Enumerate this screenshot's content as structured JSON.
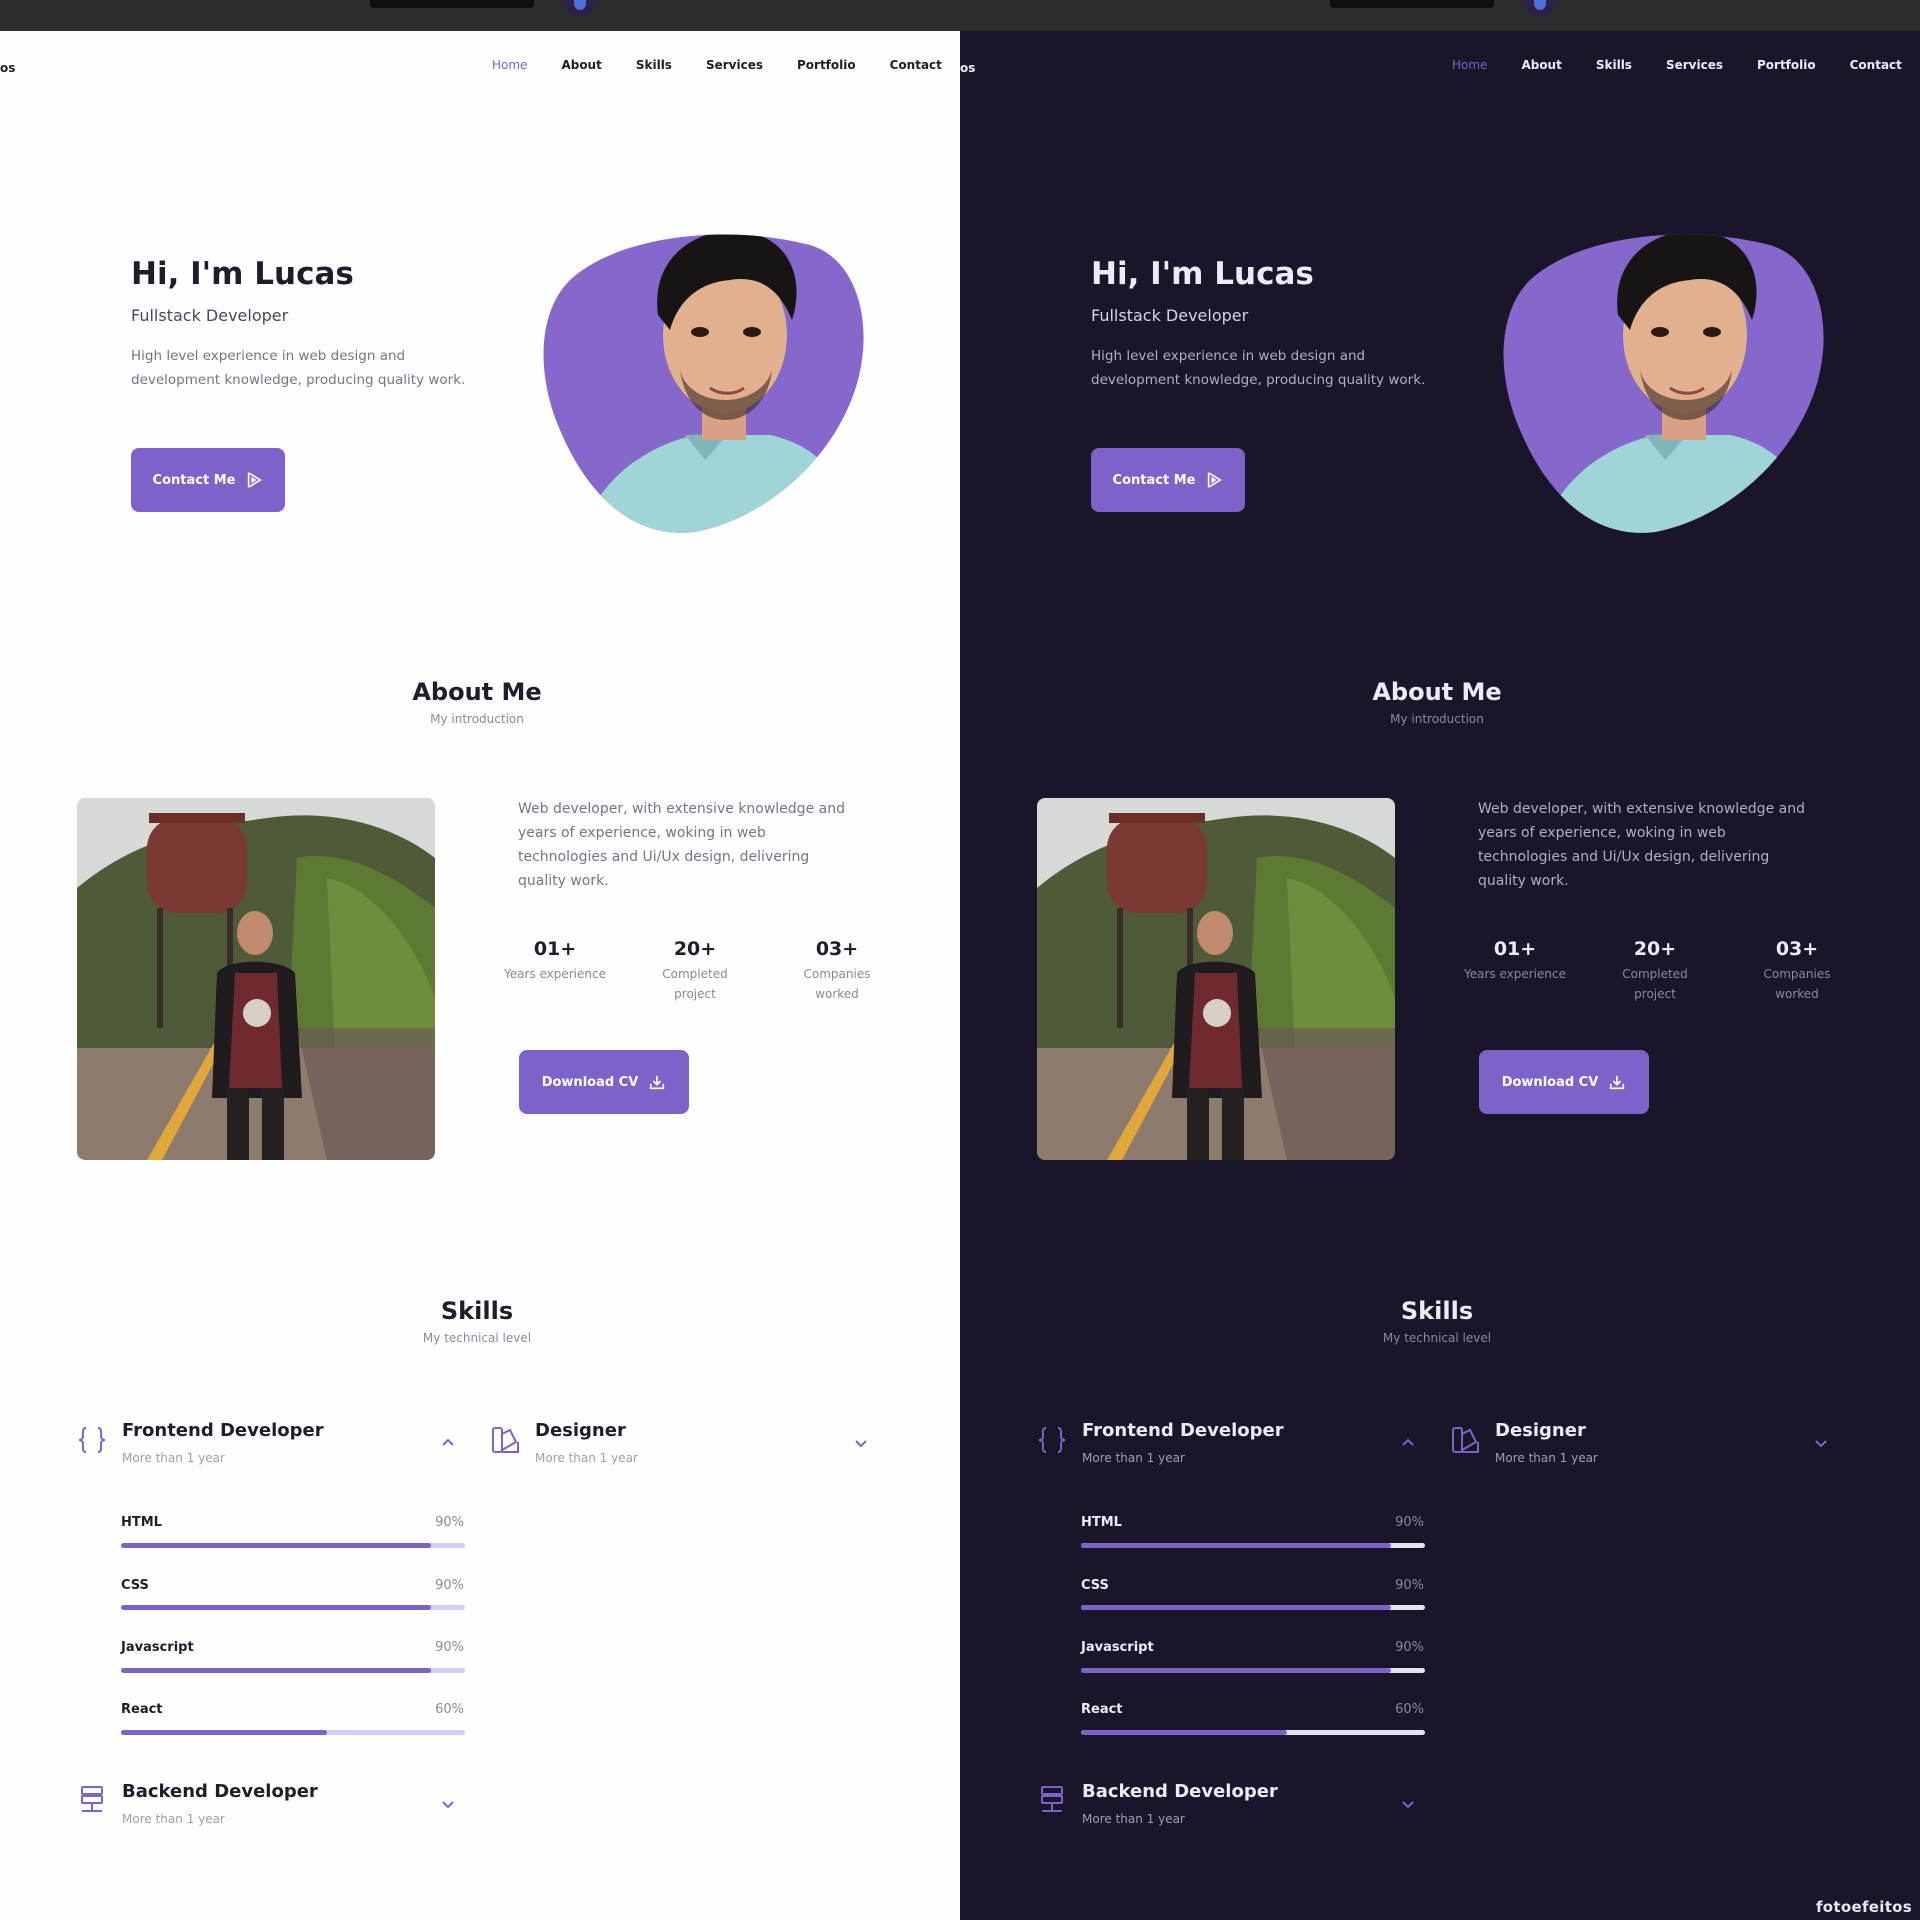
{
  "nav": {
    "logo": "os",
    "items": [
      "Home",
      "About",
      "Skills",
      "Services",
      "Portfolio",
      "Contact"
    ]
  },
  "hero": {
    "title": "Hi, I'm Lucas",
    "subtitle": "Fullstack Developer",
    "description": "High level experience in web design and development knowledge, producing quality work.",
    "button_label": "Contact Me"
  },
  "about": {
    "title": "About Me",
    "subtitle": "My introduction",
    "description": "Web developer, with extensive knowledge and years of experience, woking in web technologies and Ui/Ux design, delivering quality work.",
    "stats": [
      {
        "value": "01+",
        "label": "Years experience"
      },
      {
        "value": "20+",
        "label": "Completed project"
      },
      {
        "value": "03+",
        "label": "Companies worked"
      }
    ],
    "button_label": "Download CV"
  },
  "skills": {
    "title": "Skills",
    "subtitle": "My technical level",
    "groups": [
      {
        "name": "Frontend Developer",
        "years": "More than 1 year",
        "icon": "braces-icon",
        "expanded": true
      },
      {
        "name": "Designer",
        "years": "More than 1 year",
        "icon": "swatchbook-icon",
        "expanded": false
      },
      {
        "name": "Backend Developer",
        "years": "More than 1 year",
        "icon": "server-icon",
        "expanded": false
      }
    ],
    "items": [
      {
        "name": "HTML",
        "percent_label": "90%",
        "level": 0.9
      },
      {
        "name": "CSS",
        "percent_label": "90%",
        "level": 0.9
      },
      {
        "name": "Javascript",
        "percent_label": "90%",
        "level": 0.9
      },
      {
        "name": "React",
        "percent_label": "60%",
        "level": 0.6
      }
    ]
  },
  "themes": {
    "light_background": "#fefefe",
    "dark_background": "#1b1529",
    "accent": "#7d63c9"
  },
  "watermark": "fotoefeitos"
}
